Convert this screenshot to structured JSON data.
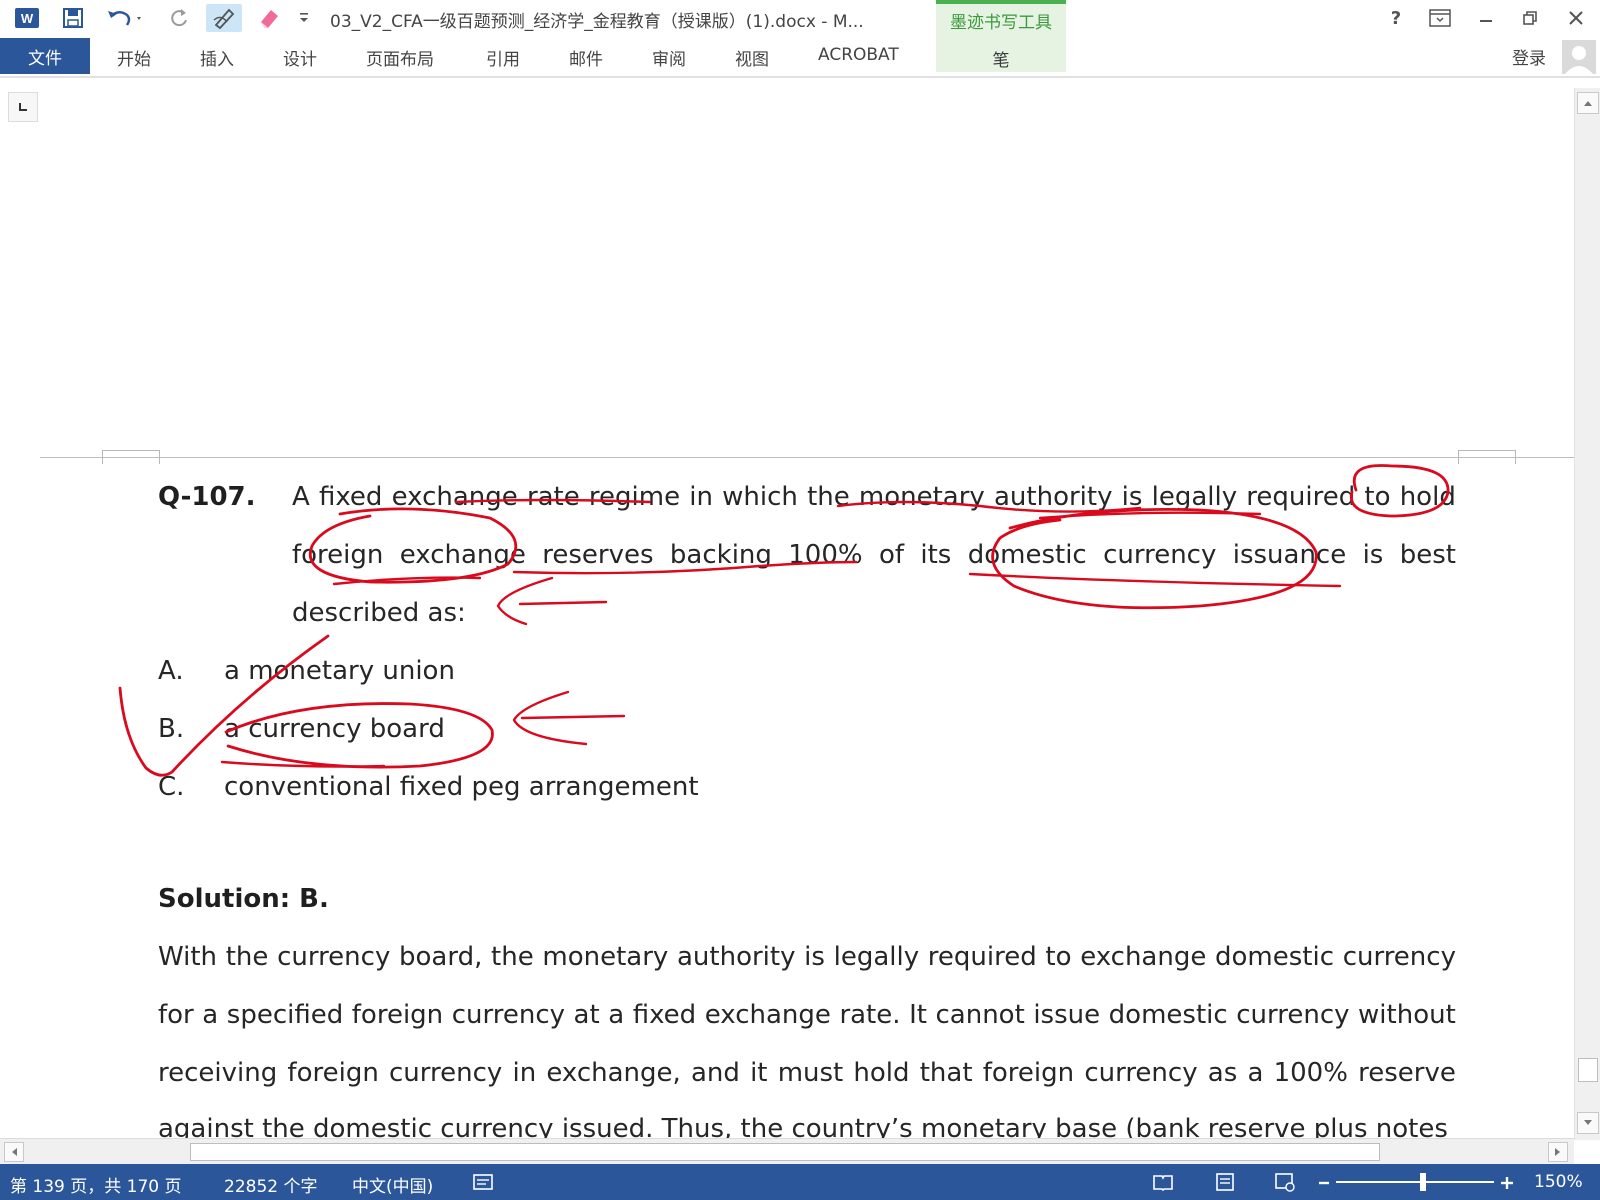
{
  "window": {
    "title": "03_V2_CFA一级百题预测_经济学_金程教育（授课版）(1).docx - M...",
    "context_tab_group": "墨迹书写工具",
    "help_label": "?"
  },
  "ribbon": {
    "file_tab": "文件",
    "tabs": [
      "开始",
      "插入",
      "设计",
      "页面布局",
      "引用",
      "邮件",
      "审阅",
      "视图",
      "ACROBAT"
    ],
    "context_tab": "笔",
    "login": "登录"
  },
  "document": {
    "question": {
      "label": "Q-107.",
      "line1": [
        "A",
        "fixed",
        "exchange",
        "rate",
        "regime",
        "in",
        "which",
        "the",
        "monetary",
        "authority",
        "is",
        "legally",
        "required",
        "to",
        "hold"
      ],
      "line2": [
        "foreign",
        "exchange",
        "reserves",
        "backing",
        "100%",
        "of",
        "its",
        "domestic",
        "currency",
        "issuance",
        "is",
        "best"
      ],
      "line3": "described as:"
    },
    "options": [
      {
        "letter": "A.",
        "text": "a monetary union"
      },
      {
        "letter": "B.",
        "text": "a currency board"
      },
      {
        "letter": "C.",
        "text": "conventional fixed peg arrangement"
      }
    ],
    "solution": {
      "label": "Solution: B.",
      "line1": [
        "With",
        "the",
        "currency",
        "board,",
        "the",
        "monetary",
        "authority",
        "is",
        "legally",
        "required",
        "to",
        "exchange",
        "domestic",
        "currency"
      ],
      "line2": [
        "for",
        "a",
        "specified",
        "foreign",
        "currency",
        "at",
        "a",
        "fixed",
        "exchange",
        "rate.",
        "It",
        "cannot",
        "issue",
        "domestic",
        "currency",
        "without"
      ],
      "line3": [
        "receiving",
        "foreign",
        "currency",
        "in",
        "exchange,",
        "and",
        "it",
        "must",
        "hold",
        "that",
        "foreign",
        "currency",
        "as",
        "a",
        "100%",
        "reserve"
      ],
      "line4": "against the domestic currency issued. Thus, the country’s monetary base (bank reserve plus notes"
    },
    "ink_color": "#d90a1e"
  },
  "statusbar": {
    "page": "第 139 页，共 170 页",
    "words": "22852 个字",
    "language": "中文(中国)",
    "zoom": "150%",
    "zoom_level_percent": 150,
    "color": "#2b579a"
  }
}
